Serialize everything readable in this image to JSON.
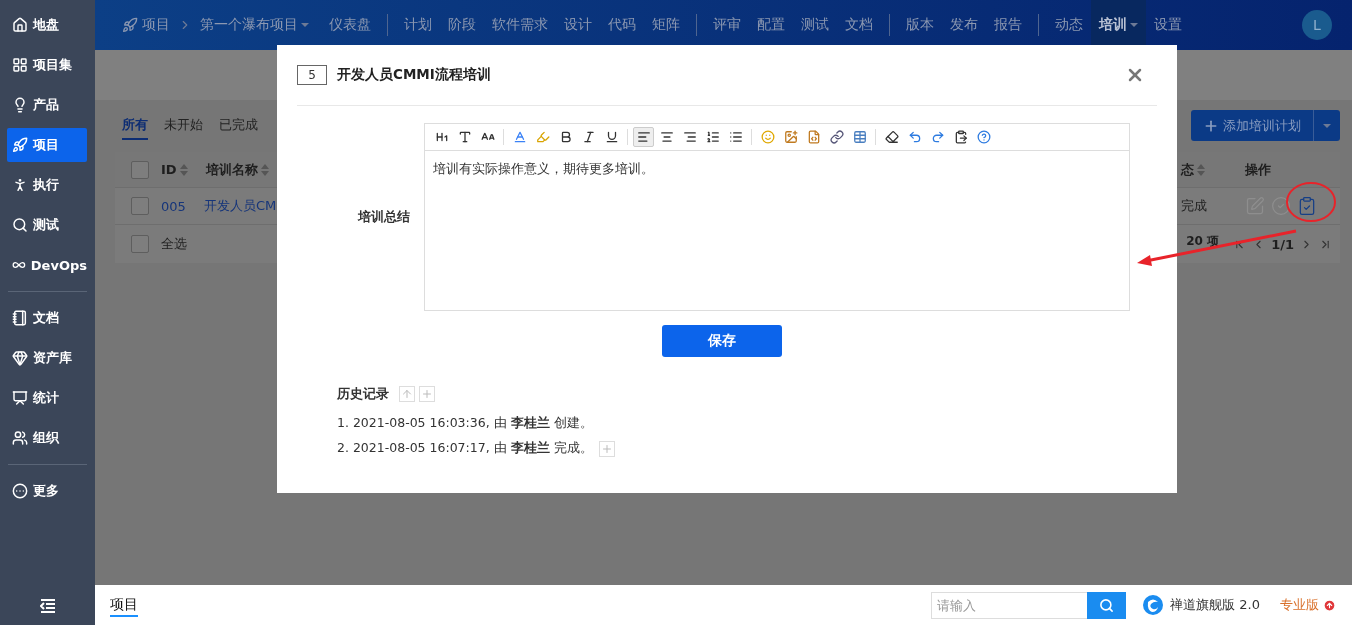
{
  "sidebar": {
    "groups": [
      [
        {
          "label": "地盘",
          "selected": false
        },
        {
          "label": "项目集",
          "selected": false
        },
        {
          "label": "产品",
          "selected": false
        },
        {
          "label": "项目",
          "selected": true
        },
        {
          "label": "执行",
          "selected": false
        },
        {
          "label": "测试",
          "selected": false
        },
        {
          "label": "DevOps",
          "selected": false
        }
      ],
      [
        {
          "label": "文档",
          "selected": false
        },
        {
          "label": "资产库",
          "selected": false
        },
        {
          "label": "统计",
          "selected": false
        },
        {
          "label": "组织",
          "selected": false
        }
      ],
      [
        {
          "label": "更多",
          "selected": false
        }
      ]
    ]
  },
  "top_nav": {
    "section": "项目",
    "project": "第一个瀑布项目",
    "groups": [
      [
        {
          "label": "仪表盘",
          "selected": false,
          "dropdown": false
        }
      ],
      [
        {
          "label": "计划",
          "selected": false,
          "dropdown": false
        },
        {
          "label": "阶段",
          "selected": false,
          "dropdown": false
        },
        {
          "label": "软件需求",
          "selected": false,
          "dropdown": false
        },
        {
          "label": "设计",
          "selected": false,
          "dropdown": false
        },
        {
          "label": "代码",
          "selected": false,
          "dropdown": false
        },
        {
          "label": "矩阵",
          "selected": false,
          "dropdown": false
        }
      ],
      [
        {
          "label": "评审",
          "selected": false,
          "dropdown": false
        },
        {
          "label": "配置",
          "selected": false,
          "dropdown": false
        },
        {
          "label": "测试",
          "selected": false,
          "dropdown": false
        },
        {
          "label": "文档",
          "selected": false,
          "dropdown": false
        }
      ],
      [
        {
          "label": "版本",
          "selected": false,
          "dropdown": false
        },
        {
          "label": "发布",
          "selected": false,
          "dropdown": false
        },
        {
          "label": "报告",
          "selected": false,
          "dropdown": false
        }
      ],
      [
        {
          "label": "动态",
          "selected": false,
          "dropdown": false
        },
        {
          "label": "培训",
          "selected": true,
          "dropdown": true
        },
        {
          "label": "设置",
          "selected": false,
          "dropdown": false
        }
      ]
    ],
    "avatar": "L"
  },
  "background": {
    "tabs": [
      {
        "label": "所有",
        "selected": true
      },
      {
        "label": "未开始",
        "selected": false
      },
      {
        "label": "已完成",
        "selected": false
      }
    ],
    "add_button": "添加培训计划",
    "table": {
      "header_checked": false,
      "select_all_checked": false,
      "columns": [
        "ID",
        "培训名称"
      ],
      "right_columns": [
        "态",
        "操作"
      ],
      "row": {
        "checked": false,
        "id": "005",
        "name": "开发人员CM",
        "status": "完成",
        "actions": [
          {
            "kind": "edit",
            "disabled": true
          },
          {
            "kind": "finish",
            "disabled": true
          },
          {
            "kind": "summary",
            "disabled": false
          }
        ]
      },
      "select_all": "全选",
      "page_size": "20 项",
      "page": "1/1"
    }
  },
  "modal": {
    "id": "5",
    "title": "开发人员CMMI流程培训",
    "field_label": "培训总结",
    "toolbar": [
      {
        "kind": "heading",
        "pressed": false
      },
      {
        "kind": "font",
        "pressed": false
      },
      {
        "kind": "font_size",
        "pressed": false
      },
      {
        "kind": "separator"
      },
      {
        "kind": "text_color",
        "pressed": false
      },
      {
        "kind": "highlight",
        "pressed": false
      },
      {
        "kind": "bold",
        "pressed": false
      },
      {
        "kind": "italic",
        "pressed": false
      },
      {
        "kind": "underline",
        "pressed": false
      },
      {
        "kind": "separator"
      },
      {
        "kind": "align_left",
        "pressed": true
      },
      {
        "kind": "align_center",
        "pressed": false
      },
      {
        "kind": "align_right",
        "pressed": false
      },
      {
        "kind": "ordered_list",
        "pressed": false
      },
      {
        "kind": "bullet_list",
        "pressed": false
      },
      {
        "kind": "separator"
      },
      {
        "kind": "emoji",
        "pressed": false
      },
      {
        "kind": "image",
        "pressed": false
      },
      {
        "kind": "code",
        "pressed": false
      },
      {
        "kind": "link",
        "pressed": false
      },
      {
        "kind": "table",
        "pressed": false
      },
      {
        "kind": "separator"
      },
      {
        "kind": "eraser",
        "pressed": false
      },
      {
        "kind": "undo",
        "pressed": false
      },
      {
        "kind": "redo",
        "pressed": false
      },
      {
        "kind": "paste",
        "pressed": false
      },
      {
        "kind": "help",
        "pressed": false
      }
    ],
    "editor_text": "培训有实际操作意义，期待更多培训。",
    "save": "保存",
    "history": {
      "title": "历史记录",
      "entries": [
        {
          "number": "1.",
          "text": "2021-08-05 16:03:36, 由 **李桂兰** 创建。",
          "expandable": false
        },
        {
          "number": "2.",
          "text": "2021-08-05 16:07:17, 由 **李桂兰** 完成。",
          "expandable": true
        }
      ]
    }
  },
  "bottom_bar": {
    "tab": "项目",
    "search_placeholder": "请输入",
    "brand": "禅道旗舰版 2.0",
    "edition": "专业版"
  }
}
